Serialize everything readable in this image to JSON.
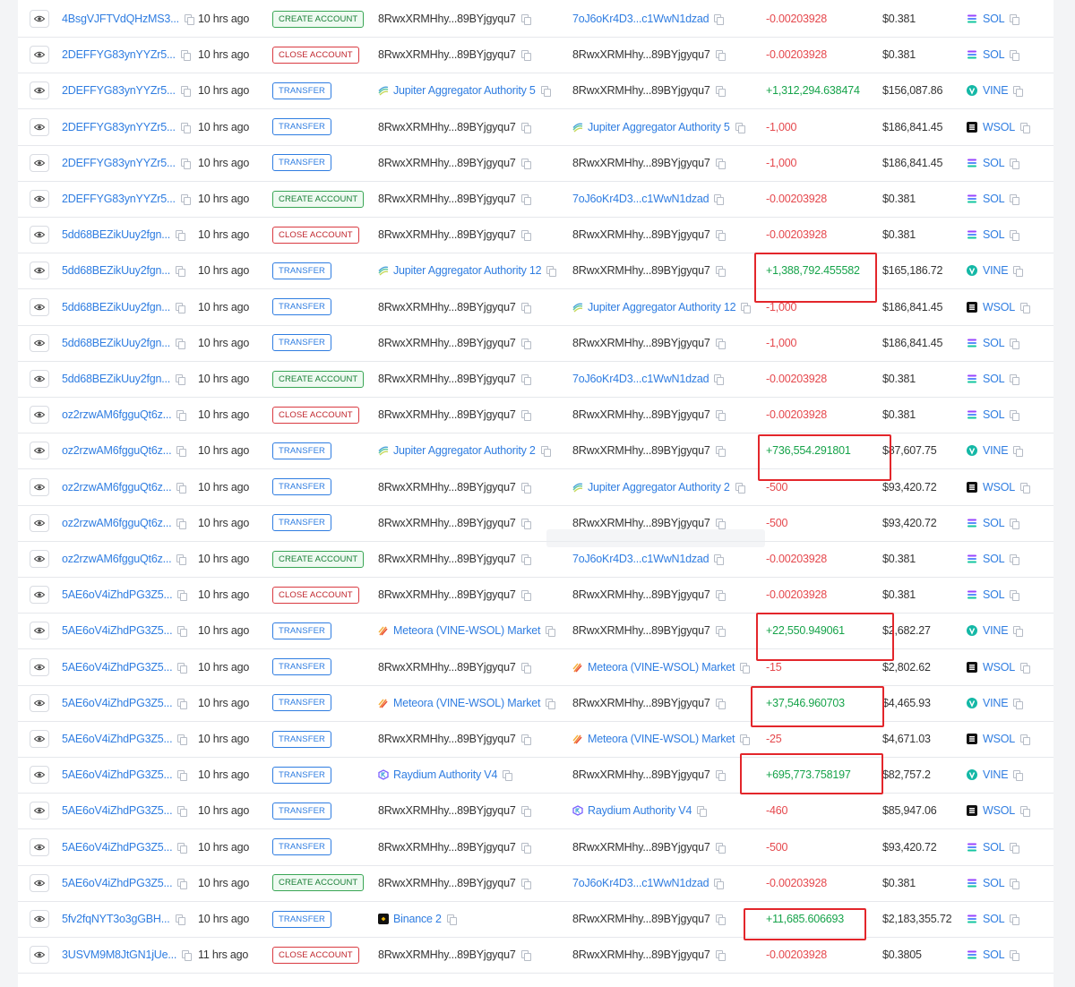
{
  "rows": [
    {
      "sig": "4BsgVJFTVdQHzMS3...",
      "time": "10 hrs ago",
      "type": "CREATE ACCOUNT",
      "from": {
        "label": "8RwxXRMHhy...89BYjgyqu7",
        "kind": "addr"
      },
      "to": {
        "label": "7oJ6oKr4D3...c1WwN1dzad",
        "kind": "link"
      },
      "amount": "-0.00203928",
      "sign": "neg",
      "value": "$0.381",
      "token": "SOL"
    },
    {
      "sig": "2DEFFYG83ynYYZr5...",
      "time": "10 hrs ago",
      "type": "CLOSE ACCOUNT",
      "from": {
        "label": "8RwxXRMHhy...89BYjgyqu7",
        "kind": "addr"
      },
      "to": {
        "label": "8RwxXRMHhy...89BYjgyqu7",
        "kind": "addr"
      },
      "amount": "-0.00203928",
      "sign": "neg",
      "value": "$0.381",
      "token": "SOL"
    },
    {
      "sig": "2DEFFYG83ynYYZr5...",
      "time": "10 hrs ago",
      "type": "TRANSFER",
      "from": {
        "label": "Jupiter Aggregator Authority 5",
        "kind": "jupiter"
      },
      "to": {
        "label": "8RwxXRMHhy...89BYjgyqu7",
        "kind": "addr"
      },
      "amount": "+1,312,294.638474",
      "sign": "pos",
      "value": "$156,087.86",
      "token": "VINE"
    },
    {
      "sig": "2DEFFYG83ynYYZr5...",
      "time": "10 hrs ago",
      "type": "TRANSFER",
      "from": {
        "label": "8RwxXRMHhy...89BYjgyqu7",
        "kind": "addr"
      },
      "to": {
        "label": "Jupiter Aggregator Authority 5",
        "kind": "jupiter"
      },
      "amount": "-1,000",
      "sign": "neg",
      "value": "$186,841.45",
      "token": "WSOL"
    },
    {
      "sig": "2DEFFYG83ynYYZr5...",
      "time": "10 hrs ago",
      "type": "TRANSFER",
      "from": {
        "label": "8RwxXRMHhy...89BYjgyqu7",
        "kind": "addr"
      },
      "to": {
        "label": "8RwxXRMHhy...89BYjgyqu7",
        "kind": "addr"
      },
      "amount": "-1,000",
      "sign": "neg",
      "value": "$186,841.45",
      "token": "SOL"
    },
    {
      "sig": "2DEFFYG83ynYYZr5...",
      "time": "10 hrs ago",
      "type": "CREATE ACCOUNT",
      "from": {
        "label": "8RwxXRMHhy...89BYjgyqu7",
        "kind": "addr"
      },
      "to": {
        "label": "7oJ6oKr4D3...c1WwN1dzad",
        "kind": "link"
      },
      "amount": "-0.00203928",
      "sign": "neg",
      "value": "$0.381",
      "token": "SOL"
    },
    {
      "sig": "5dd68BEZikUuy2fgn...",
      "time": "10 hrs ago",
      "type": "CLOSE ACCOUNT",
      "from": {
        "label": "8RwxXRMHhy...89BYjgyqu7",
        "kind": "addr"
      },
      "to": {
        "label": "8RwxXRMHhy...89BYjgyqu7",
        "kind": "addr"
      },
      "amount": "-0.00203928",
      "sign": "neg",
      "value": "$0.381",
      "token": "SOL"
    },
    {
      "sig": "5dd68BEZikUuy2fgn...",
      "time": "10 hrs ago",
      "type": "TRANSFER",
      "from": {
        "label": "Jupiter Aggregator Authority 12",
        "kind": "jupiter"
      },
      "to": {
        "label": "8RwxXRMHhy...89BYjgyqu7",
        "kind": "addr"
      },
      "amount": "+1,388,792.455582",
      "sign": "pos",
      "value": "$165,186.72",
      "token": "VINE"
    },
    {
      "sig": "5dd68BEZikUuy2fgn...",
      "time": "10 hrs ago",
      "type": "TRANSFER",
      "from": {
        "label": "8RwxXRMHhy...89BYjgyqu7",
        "kind": "addr"
      },
      "to": {
        "label": "Jupiter Aggregator Authority 12",
        "kind": "jupiter"
      },
      "amount": "-1,000",
      "sign": "neg",
      "value": "$186,841.45",
      "token": "WSOL"
    },
    {
      "sig": "5dd68BEZikUuy2fgn...",
      "time": "10 hrs ago",
      "type": "TRANSFER",
      "from": {
        "label": "8RwxXRMHhy...89BYjgyqu7",
        "kind": "addr"
      },
      "to": {
        "label": "8RwxXRMHhy...89BYjgyqu7",
        "kind": "addr"
      },
      "amount": "-1,000",
      "sign": "neg",
      "value": "$186,841.45",
      "token": "SOL"
    },
    {
      "sig": "5dd68BEZikUuy2fgn...",
      "time": "10 hrs ago",
      "type": "CREATE ACCOUNT",
      "from": {
        "label": "8RwxXRMHhy...89BYjgyqu7",
        "kind": "addr"
      },
      "to": {
        "label": "7oJ6oKr4D3...c1WwN1dzad",
        "kind": "link"
      },
      "amount": "-0.00203928",
      "sign": "neg",
      "value": "$0.381",
      "token": "SOL"
    },
    {
      "sig": "oz2rzwAM6fgguQt6z...",
      "time": "10 hrs ago",
      "type": "CLOSE ACCOUNT",
      "from": {
        "label": "8RwxXRMHhy...89BYjgyqu7",
        "kind": "addr"
      },
      "to": {
        "label": "8RwxXRMHhy...89BYjgyqu7",
        "kind": "addr"
      },
      "amount": "-0.00203928",
      "sign": "neg",
      "value": "$0.381",
      "token": "SOL"
    },
    {
      "sig": "oz2rzwAM6fgguQt6z...",
      "time": "10 hrs ago",
      "type": "TRANSFER",
      "from": {
        "label": "Jupiter Aggregator Authority 2",
        "kind": "jupiter"
      },
      "to": {
        "label": "8RwxXRMHhy...89BYjgyqu7",
        "kind": "addr"
      },
      "amount": "+736,554.291801",
      "sign": "pos",
      "value": "$87,607.75",
      "token": "VINE"
    },
    {
      "sig": "oz2rzwAM6fgguQt6z...",
      "time": "10 hrs ago",
      "type": "TRANSFER",
      "from": {
        "label": "8RwxXRMHhy...89BYjgyqu7",
        "kind": "addr"
      },
      "to": {
        "label": "Jupiter Aggregator Authority 2",
        "kind": "jupiter"
      },
      "amount": "-500",
      "sign": "neg",
      "value": "$93,420.72",
      "token": "WSOL"
    },
    {
      "sig": "oz2rzwAM6fgguQt6z...",
      "time": "10 hrs ago",
      "type": "TRANSFER",
      "from": {
        "label": "8RwxXRMHhy...89BYjgyqu7",
        "kind": "addr"
      },
      "to": {
        "label": "8RwxXRMHhy...89BYjgyqu7",
        "kind": "addr"
      },
      "amount": "-500",
      "sign": "neg",
      "value": "$93,420.72",
      "token": "SOL"
    },
    {
      "sig": "oz2rzwAM6fgguQt6z...",
      "time": "10 hrs ago",
      "type": "CREATE ACCOUNT",
      "from": {
        "label": "8RwxXRMHhy...89BYjgyqu7",
        "kind": "addr"
      },
      "to": {
        "label": "7oJ6oKr4D3...c1WwN1dzad",
        "kind": "link"
      },
      "amount": "-0.00203928",
      "sign": "neg",
      "value": "$0.381",
      "token": "SOL"
    },
    {
      "sig": "5AE6oV4iZhdPG3Z5...",
      "time": "10 hrs ago",
      "type": "CLOSE ACCOUNT",
      "from": {
        "label": "8RwxXRMHhy...89BYjgyqu7",
        "kind": "addr"
      },
      "to": {
        "label": "8RwxXRMHhy...89BYjgyqu7",
        "kind": "addr"
      },
      "amount": "-0.00203928",
      "sign": "neg",
      "value": "$0.381",
      "token": "SOL"
    },
    {
      "sig": "5AE6oV4iZhdPG3Z5...",
      "time": "10 hrs ago",
      "type": "TRANSFER",
      "from": {
        "label": "Meteora (VINE-WSOL) Market",
        "kind": "meteora"
      },
      "to": {
        "label": "8RwxXRMHhy...89BYjgyqu7",
        "kind": "addr"
      },
      "amount": "+22,550.949061",
      "sign": "pos",
      "value": "$2,682.27",
      "token": "VINE"
    },
    {
      "sig": "5AE6oV4iZhdPG3Z5...",
      "time": "10 hrs ago",
      "type": "TRANSFER",
      "from": {
        "label": "8RwxXRMHhy...89BYjgyqu7",
        "kind": "addr"
      },
      "to": {
        "label": "Meteora (VINE-WSOL) Market",
        "kind": "meteora"
      },
      "amount": "-15",
      "sign": "neg",
      "value": "$2,802.62",
      "token": "WSOL"
    },
    {
      "sig": "5AE6oV4iZhdPG3Z5...",
      "time": "10 hrs ago",
      "type": "TRANSFER",
      "from": {
        "label": "Meteora (VINE-WSOL) Market",
        "kind": "meteora"
      },
      "to": {
        "label": "8RwxXRMHhy...89BYjgyqu7",
        "kind": "addr"
      },
      "amount": "+37,546.960703",
      "sign": "pos",
      "value": "$4,465.93",
      "token": "VINE"
    },
    {
      "sig": "5AE6oV4iZhdPG3Z5...",
      "time": "10 hrs ago",
      "type": "TRANSFER",
      "from": {
        "label": "8RwxXRMHhy...89BYjgyqu7",
        "kind": "addr"
      },
      "to": {
        "label": "Meteora (VINE-WSOL) Market",
        "kind": "meteora"
      },
      "amount": "-25",
      "sign": "neg",
      "value": "$4,671.03",
      "token": "WSOL"
    },
    {
      "sig": "5AE6oV4iZhdPG3Z5...",
      "time": "10 hrs ago",
      "type": "TRANSFER",
      "from": {
        "label": "Raydium Authority V4",
        "kind": "raydium"
      },
      "to": {
        "label": "8RwxXRMHhy...89BYjgyqu7",
        "kind": "addr"
      },
      "amount": "+695,773.758197",
      "sign": "pos",
      "value": "$82,757.2",
      "token": "VINE"
    },
    {
      "sig": "5AE6oV4iZhdPG3Z5...",
      "time": "10 hrs ago",
      "type": "TRANSFER",
      "from": {
        "label": "8RwxXRMHhy...89BYjgyqu7",
        "kind": "addr"
      },
      "to": {
        "label": "Raydium Authority V4",
        "kind": "raydium"
      },
      "amount": "-460",
      "sign": "neg",
      "value": "$85,947.06",
      "token": "WSOL"
    },
    {
      "sig": "5AE6oV4iZhdPG3Z5...",
      "time": "10 hrs ago",
      "type": "TRANSFER",
      "from": {
        "label": "8RwxXRMHhy...89BYjgyqu7",
        "kind": "addr"
      },
      "to": {
        "label": "8RwxXRMHhy...89BYjgyqu7",
        "kind": "addr"
      },
      "amount": "-500",
      "sign": "neg",
      "value": "$93,420.72",
      "token": "SOL"
    },
    {
      "sig": "5AE6oV4iZhdPG3Z5...",
      "time": "10 hrs ago",
      "type": "CREATE ACCOUNT",
      "from": {
        "label": "8RwxXRMHhy...89BYjgyqu7",
        "kind": "addr"
      },
      "to": {
        "label": "7oJ6oKr4D3...c1WwN1dzad",
        "kind": "link"
      },
      "amount": "-0.00203928",
      "sign": "neg",
      "value": "$0.381",
      "token": "SOL"
    },
    {
      "sig": "5fv2fqNYT3o3gGBH...",
      "time": "10 hrs ago",
      "type": "TRANSFER",
      "from": {
        "label": "Binance 2",
        "kind": "binance"
      },
      "to": {
        "label": "8RwxXRMHhy...89BYjgyqu7",
        "kind": "addr"
      },
      "amount": "+11,685.606693",
      "sign": "pos",
      "value": "$2,183,355.72",
      "token": "SOL"
    },
    {
      "sig": "3USVM9M8JtGN1jUe...",
      "time": "11 hrs ago",
      "type": "CLOSE ACCOUNT",
      "from": {
        "label": "8RwxXRMHhy...89BYjgyqu7",
        "kind": "addr"
      },
      "to": {
        "label": "8RwxXRMHhy...89BYjgyqu7",
        "kind": "addr"
      },
      "amount": "-0.00203928",
      "sign": "neg",
      "value": "$0.3805",
      "token": "SOL"
    }
  ],
  "highlighted_rows": [
    7,
    12,
    17,
    19,
    21,
    25
  ],
  "colors": {
    "positive": "#16a34a",
    "negative": "#e5484d",
    "link": "#2f7de1",
    "highlight": "#e3262b"
  }
}
